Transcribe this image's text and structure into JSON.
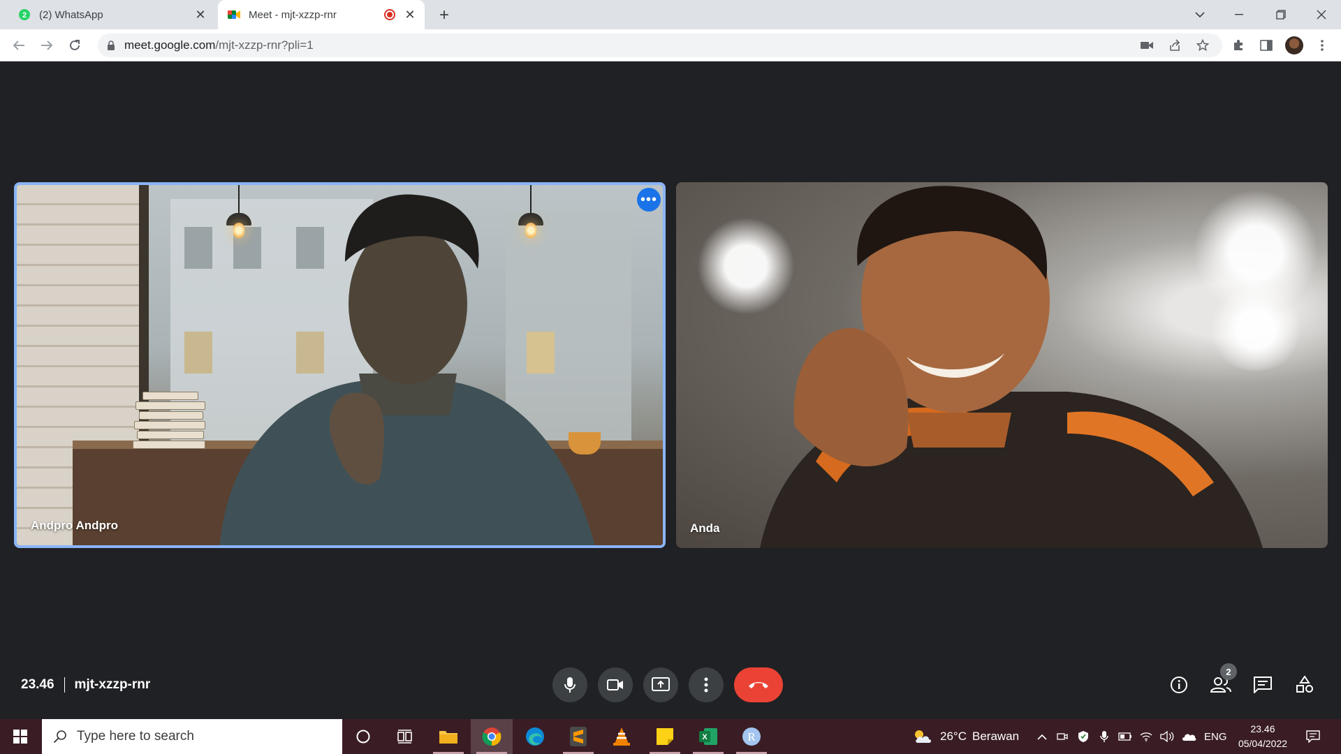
{
  "browser": {
    "tabs": [
      {
        "title": "(2) WhatsApp",
        "badge": "2",
        "active": false
      },
      {
        "title": "Meet - mjt-xzzp-rnr",
        "recording": true,
        "active": true
      }
    ],
    "url_host": "meet.google.com",
    "url_path": "/mjt-xzzp-rnr?pli=1"
  },
  "meet": {
    "time": "23.46",
    "meeting_code": "mjt-xzzp-rnr",
    "participants_count": "2",
    "tiles": [
      {
        "name": "Andpro Andpro",
        "active_speaker": true
      },
      {
        "name": "Anda",
        "active_speaker": false
      }
    ],
    "colors": {
      "end_call": "#ea4335",
      "active_border": "#8ab4f8",
      "options_button": "#1a73e8"
    }
  },
  "taskbar": {
    "search_placeholder": "Type here to search",
    "weather_temp": "26°C",
    "weather_desc": "Berawan",
    "language": "ENG",
    "clock_time": "23.46",
    "clock_date": "05/04/2022",
    "pinned_apps": [
      "cortana-icon",
      "task-view-icon",
      "file-explorer-icon",
      "chrome-icon",
      "edge-icon",
      "sublime-text-icon",
      "vlc-icon",
      "sticky-notes-icon",
      "excel-icon",
      "r-icon"
    ]
  }
}
